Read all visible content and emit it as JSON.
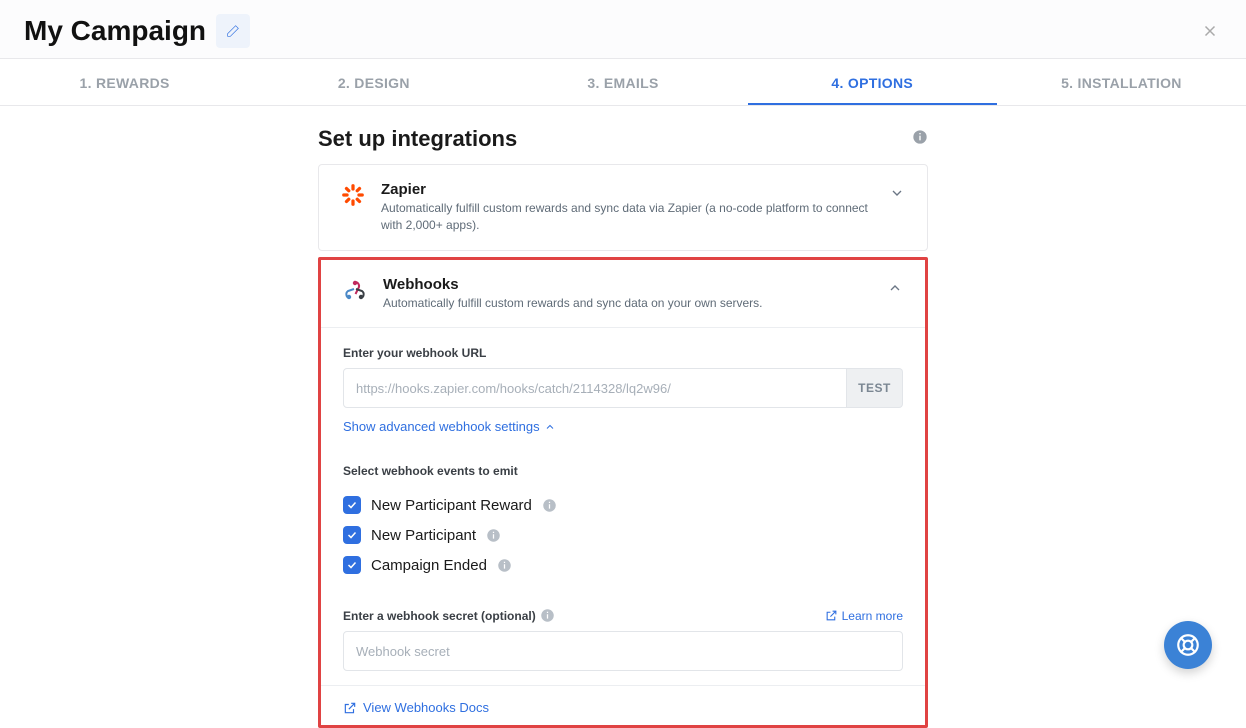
{
  "header": {
    "title": "My Campaign"
  },
  "tabs": [
    {
      "label": "1. REWARDS"
    },
    {
      "label": "2. DESIGN"
    },
    {
      "label": "3. EMAILS"
    },
    {
      "label": "4. OPTIONS"
    },
    {
      "label": "5. INSTALLATION"
    }
  ],
  "section": {
    "title": "Set up integrations"
  },
  "zapier": {
    "title": "Zapier",
    "desc": "Automatically fulfill custom rewards and sync data via Zapier (a no-code platform to connect with 2,000+ apps)."
  },
  "webhooks": {
    "title": "Webhooks",
    "desc": "Automatically fulfill custom rewards and sync data on your own servers.",
    "url_label": "Enter your webhook URL",
    "url_placeholder": "https://hooks.zapier.com/hooks/catch/2114328/lq2w96/",
    "test_label": "TEST",
    "advanced_link": "Show advanced webhook settings",
    "events_label": "Select webhook events to emit",
    "events": [
      {
        "label": "New Participant Reward"
      },
      {
        "label": "New Participant"
      },
      {
        "label": "Campaign Ended"
      }
    ],
    "secret_label": "Enter a webhook secret (optional)",
    "learn_more": "Learn more",
    "secret_placeholder": "Webhook secret",
    "docs_link": "View Webhooks Docs"
  }
}
